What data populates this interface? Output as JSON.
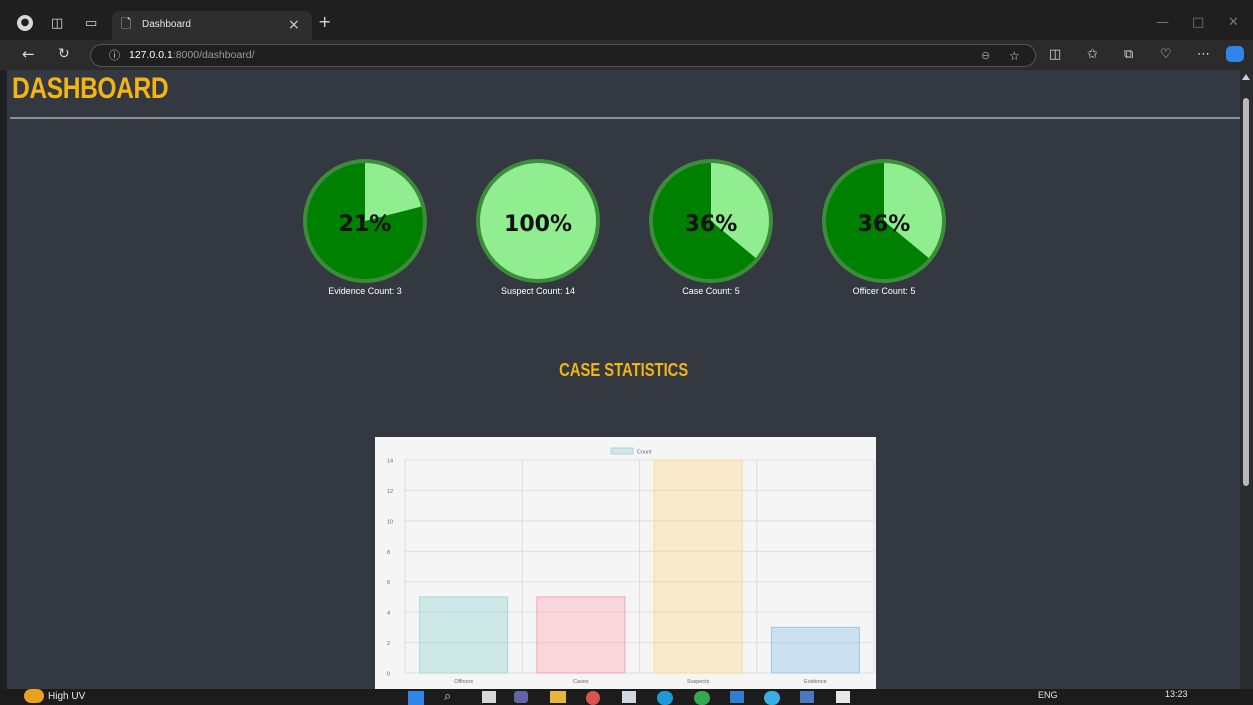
{
  "browser": {
    "tab_title": "Dashboard",
    "tab_close": "×",
    "new_tab": "+",
    "url_host": "127.0.0.1",
    "url_rest": ":8000/dashboard/"
  },
  "page": {
    "title": "DASHBOARD",
    "section_title": "CASE STATISTICS"
  },
  "gauges": [
    {
      "percent_text": "21%",
      "fraction": 0.21,
      "label": "Evidence Count: 3"
    },
    {
      "percent_text": "100%",
      "fraction": 1.0,
      "label": "Suspect Count: 14"
    },
    {
      "percent_text": "36%",
      "fraction": 0.36,
      "label": "Case Count: 5"
    },
    {
      "percent_text": "36%",
      "fraction": 0.36,
      "label": "Officer Count: 5"
    }
  ],
  "colors": {
    "accent": "#f2b515",
    "gauge_fill": "#90ee90",
    "gauge_base": "#008000",
    "gauge_ring": "#3c8c3c"
  },
  "chart_data": {
    "type": "bar",
    "categories": [
      "Officers",
      "Cases",
      "Suspects",
      "Evidence"
    ],
    "series": [
      {
        "name": "Count",
        "values": [
          5,
          5,
          14,
          3
        ]
      }
    ],
    "ylim": [
      0,
      14
    ],
    "yticks": [
      "0",
      "2",
      "4",
      "6",
      "8",
      "10",
      "12",
      "14"
    ],
    "legend": "top-center",
    "grid": true,
    "bar_fills": [
      "rgba(160,215,215,0.45)",
      "rgba(255,175,190,0.45)",
      "rgba(255,215,130,0.35)",
      "rgba(150,200,235,0.45)"
    ],
    "bar_strokes": [
      "#a9d8d8",
      "#f3a7b7",
      "#f3dca0",
      "#9cc7e6"
    ]
  },
  "taskbar": {
    "weather": "High UV",
    "language": "ENG",
    "time": "13:23"
  }
}
